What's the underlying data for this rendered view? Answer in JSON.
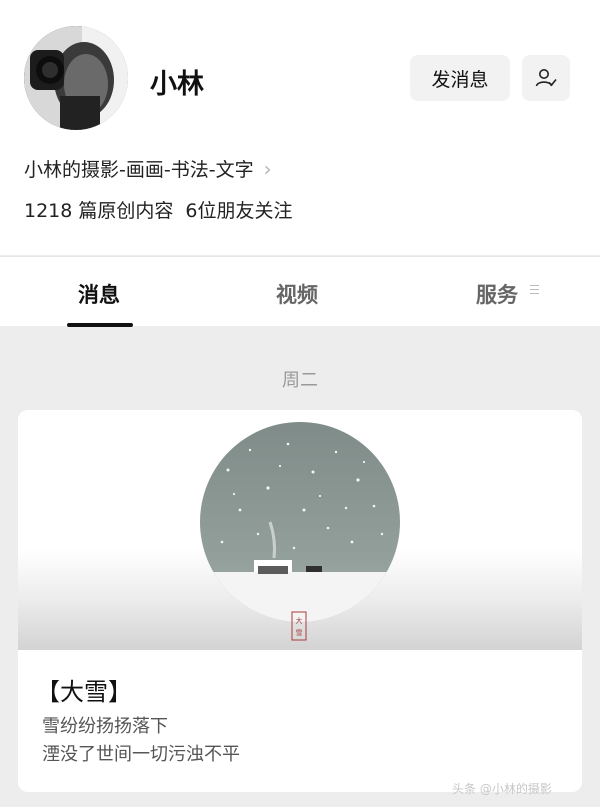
{
  "profile": {
    "name": "小林",
    "avatar_icon": "portrait-with-camera",
    "send_message_label": "发消息",
    "follow_icon": "user-check-icon",
    "description": "小林的摄影-画画-书法-文字",
    "article_count": "1218 篇原创内容",
    "friends_following": "6位朋友关注"
  },
  "tabs": [
    {
      "label": "消息",
      "active": true
    },
    {
      "label": "视频",
      "active": false
    },
    {
      "label": "服务",
      "active": false
    }
  ],
  "feed": {
    "date_label": "周二",
    "card": {
      "title": "【大雪】",
      "line1": "雪纷纷扬扬落下",
      "line2": "湮没了世间一切污浊不平",
      "seal_text": "大雪"
    }
  },
  "watermark": "头条 @小林的摄影"
}
